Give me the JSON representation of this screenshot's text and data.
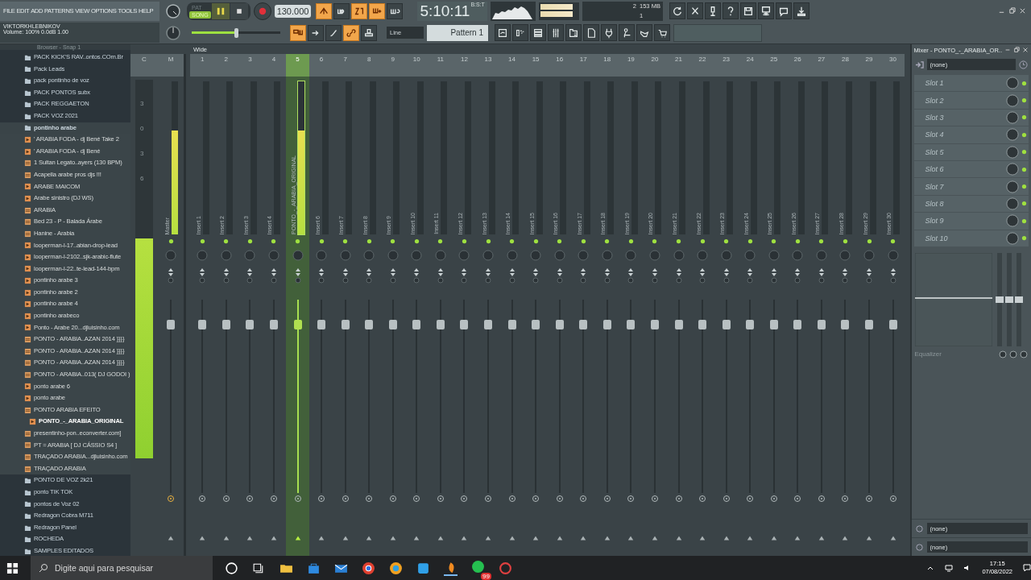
{
  "menu": [
    "FILE",
    "EDIT",
    "ADD",
    "PATTERNS",
    "VIEW",
    "OPTIONS",
    "TOOLS",
    "HELP"
  ],
  "hint": {
    "title": "VIKTORKHLEBNIKOV",
    "text": "Volume: 100%  0.0dB  1.00"
  },
  "transport": {
    "modes": [
      {
        "label": "PAT",
        "selected": false
      },
      {
        "label": "SONG",
        "selected": true
      }
    ],
    "tempo": "130.000",
    "time": "5:10:11",
    "time_unit": "B:S:T",
    "master_pitch": {
      "level": 0.5
    }
  },
  "toggles_top": [
    {
      "on": true
    },
    {
      "on": false
    },
    {
      "on": true
    },
    {
      "on": true
    },
    {
      "on": false
    }
  ],
  "toggles_bottom": [
    {
      "on": true
    },
    {
      "on": false
    },
    {
      "on": false
    },
    {
      "on": true
    },
    {
      "on": false
    }
  ],
  "cpu": {
    "voices": "2",
    "memory": "153 MB",
    "polyphony": "1"
  },
  "snap": "Line",
  "pattern": "Pattern 1",
  "browser": {
    "title": "Browser - Snap 1",
    "items": [
      {
        "kind": "folder",
        "name": "PACK KICK'S RAV..ontos.COm.Br",
        "selected": false
      },
      {
        "kind": "folder",
        "name": "Pack Leads",
        "selected": false
      },
      {
        "kind": "folder",
        "name": "pack pontinho de voz",
        "selected": false
      },
      {
        "kind": "folder",
        "name": "PACK PONTOS subx",
        "selected": false
      },
      {
        "kind": "folder",
        "name": "PACK REGGAETON",
        "selected": false
      },
      {
        "kind": "folder",
        "name": "PACK VOZ 2021",
        "selected": false
      },
      {
        "kind": "folder",
        "name": "pontinho arabe",
        "selected": false,
        "children": [
          {
            "kind": "audio",
            "name": "' ARABIA FODA -  dj Bené Take 2",
            "selected": false
          },
          {
            "kind": "audio",
            "name": "' ARABIA FODA -  dj Bené",
            "selected": false
          },
          {
            "kind": "mp3",
            "name": "1 Sultan Legato..ayers  (130 BPM)",
            "selected": false
          },
          {
            "kind": "mp3",
            "name": "Acapella arabe pros djs !!!",
            "selected": false
          },
          {
            "kind": "audio",
            "name": "ARABE MAICOM",
            "selected": false
          },
          {
            "kind": "audio",
            "name": "Arabe sinistro (DJ WS)",
            "selected": false
          },
          {
            "kind": "mp3",
            "name": "ARABIA",
            "selected": false
          },
          {
            "kind": "mp3",
            "name": "Bed 23 - P - Balada Árabe",
            "selected": false
          },
          {
            "kind": "mp3",
            "name": "Hanine - Arabia",
            "selected": false
          },
          {
            "kind": "audio",
            "name": "looperman-l-17..abian-drop-lead",
            "selected": false
          },
          {
            "kind": "audio",
            "name": "looperman-l-2102..sjk-arabic-flute",
            "selected": false
          },
          {
            "kind": "audio",
            "name": "looperman-l-22..te-lead-144-bpm",
            "selected": false
          },
          {
            "kind": "audio",
            "name": "pontinho  arabe 3",
            "selected": false
          },
          {
            "kind": "audio",
            "name": "pontinho arabe 2",
            "selected": false
          },
          {
            "kind": "audio",
            "name": "pontinho arabe 4",
            "selected": false
          },
          {
            "kind": "audio",
            "name": "pontinho arabeco",
            "selected": false
          },
          {
            "kind": "audio",
            "name": "Ponto - Arabe 20...djluisinho.com",
            "selected": false
          },
          {
            "kind": "mp3",
            "name": "PONTO - ARABIA..AZAN 2014 }}}}",
            "selected": false
          },
          {
            "kind": "mp3",
            "name": "PONTO - ARABIA..AZAN 2014 }}}}",
            "selected": false
          },
          {
            "kind": "mp3",
            "name": "PONTO - ARABIA..AZAN 2014 }}}}",
            "selected": false
          },
          {
            "kind": "mp3",
            "name": "PONTO - ARABIA..013( DJ GODOI )",
            "selected": false
          },
          {
            "kind": "audio",
            "name": "ponto arabe 6",
            "selected": false
          },
          {
            "kind": "audio",
            "name": "ponto arabe",
            "selected": false
          },
          {
            "kind": "mp3",
            "name": "PONTO ARABIA EFEITO",
            "selected": false,
            "children": [
              {
                "kind": "audio",
                "name": "PONTO_-_ARABIA_ORIGINAL",
                "selected": true
              }
            ]
          },
          {
            "kind": "mp3",
            "name": "presentinho-pon..econverter.com]",
            "selected": false
          },
          {
            "kind": "mp3",
            "name": "PT = ARABIA [ DJ CÁSSIO S4 ]",
            "selected": false
          },
          {
            "kind": "mp3",
            "name": "TRAÇADO ARABIA...djluisinho.com",
            "selected": false
          },
          {
            "kind": "mp3",
            "name": "TRAÇADO ARABIA",
            "selected": false
          }
        ]
      },
      {
        "kind": "folder",
        "name": "PONTO DE VOZ 2k21",
        "selected": false
      },
      {
        "kind": "folder",
        "name": "ponto TIK TOK",
        "selected": false
      },
      {
        "kind": "folder",
        "name": "pontos de Voz 02",
        "selected": false
      },
      {
        "kind": "folder",
        "name": "Redragon Cobra M711",
        "selected": false
      },
      {
        "kind": "folder",
        "name": "Redragon Panel",
        "selected": false
      },
      {
        "kind": "folder",
        "name": "ROCHEDA",
        "selected": false
      },
      {
        "kind": "folder",
        "name": "SAMPLES EDITADOS",
        "selected": false
      }
    ]
  },
  "mixer": {
    "stereo_mode": "Wide",
    "current": {
      "label": "C",
      "scale": [
        "3",
        "0",
        "3",
        "6"
      ],
      "meter": {
        "level": 0.58
      }
    },
    "channels": [
      {
        "label": "M",
        "name": "Master",
        "selected": false,
        "meter": {
          "level": 0.68
        },
        "fader": {
          "level": 0.87
        }
      },
      {
        "label": "1",
        "name": "Insert 1",
        "selected": false,
        "fader": {
          "level": 0.87
        }
      },
      {
        "label": "2",
        "name": "Insert 2",
        "selected": false,
        "fader": {
          "level": 0.87
        }
      },
      {
        "label": "3",
        "name": "Insert 3",
        "selected": false,
        "fader": {
          "level": 0.87
        }
      },
      {
        "label": "4",
        "name": "Insert 4",
        "selected": false,
        "fader": {
          "level": 0.87
        }
      },
      {
        "label": "5",
        "name": "PONTO_-_ARABIA_ORIGINAL",
        "selected": true,
        "meter": {
          "level": 0.68
        },
        "fader": {
          "level": 0.87
        }
      },
      {
        "label": "6",
        "name": "Insert 6",
        "selected": false,
        "fader": {
          "level": 0.87
        }
      },
      {
        "label": "7",
        "name": "Insert 7",
        "selected": false,
        "fader": {
          "level": 0.87
        }
      },
      {
        "label": "8",
        "name": "Insert 8",
        "selected": false,
        "fader": {
          "level": 0.87
        }
      },
      {
        "label": "9",
        "name": "Insert 9",
        "selected": false,
        "fader": {
          "level": 0.87
        }
      },
      {
        "label": "10",
        "name": "Insert 10",
        "selected": false,
        "fader": {
          "level": 0.87
        }
      },
      {
        "label": "11",
        "name": "Insert 11",
        "selected": false,
        "fader": {
          "level": 0.87
        }
      },
      {
        "label": "12",
        "name": "Insert 12",
        "selected": false,
        "fader": {
          "level": 0.87
        }
      },
      {
        "label": "13",
        "name": "Insert 13",
        "selected": false,
        "fader": {
          "level": 0.87
        }
      },
      {
        "label": "14",
        "name": "Insert 14",
        "selected": false,
        "fader": {
          "level": 0.87
        }
      },
      {
        "label": "15",
        "name": "Insert 15",
        "selected": false,
        "fader": {
          "level": 0.87
        }
      },
      {
        "label": "16",
        "name": "Insert 16",
        "selected": false,
        "fader": {
          "level": 0.87
        }
      },
      {
        "label": "17",
        "name": "Insert 17",
        "selected": false,
        "fader": {
          "level": 0.87
        }
      },
      {
        "label": "18",
        "name": "Insert 18",
        "selected": false,
        "fader": {
          "level": 0.87
        }
      },
      {
        "label": "19",
        "name": "Insert 19",
        "selected": false,
        "fader": {
          "level": 0.87
        }
      },
      {
        "label": "20",
        "name": "Insert 20",
        "selected": false,
        "fader": {
          "level": 0.87
        }
      },
      {
        "label": "21",
        "name": "Insert 21",
        "selected": false,
        "fader": {
          "level": 0.87
        }
      },
      {
        "label": "22",
        "name": "Insert 22",
        "selected": false,
        "fader": {
          "level": 0.87
        }
      },
      {
        "label": "23",
        "name": "Insert 23",
        "selected": false,
        "fader": {
          "level": 0.87
        }
      },
      {
        "label": "24",
        "name": "Insert 24",
        "selected": false,
        "fader": {
          "level": 0.87
        }
      },
      {
        "label": "25",
        "name": "Insert 25",
        "selected": false,
        "fader": {
          "level": 0.87
        }
      },
      {
        "label": "26",
        "name": "Insert 26",
        "selected": false,
        "fader": {
          "level": 0.87
        }
      },
      {
        "label": "27",
        "name": "Insert 27",
        "selected": false,
        "fader": {
          "level": 0.87
        }
      },
      {
        "label": "28",
        "name": "Insert 28",
        "selected": false,
        "fader": {
          "level": 0.87
        }
      },
      {
        "label": "29",
        "name": "Insert 29",
        "selected": false,
        "fader": {
          "level": 0.87
        }
      },
      {
        "label": "30",
        "name": "Insert 30",
        "selected": false,
        "fader": {
          "level": 0.87
        }
      }
    ]
  },
  "inspector": {
    "title": "Mixer - PONTO_-_ARABIA_OR..",
    "input": "(none)",
    "slots": [
      {
        "name": "Slot 1",
        "on": true
      },
      {
        "name": "Slot 2",
        "on": true
      },
      {
        "name": "Slot 3",
        "on": true
      },
      {
        "name": "Slot 4",
        "on": true
      },
      {
        "name": "Slot 5",
        "on": true
      },
      {
        "name": "Slot 6",
        "on": true
      },
      {
        "name": "Slot 7",
        "on": true
      },
      {
        "name": "Slot 8",
        "on": true
      },
      {
        "name": "Slot 9",
        "on": true
      },
      {
        "name": "Slot 10",
        "on": true
      }
    ],
    "eq_bands": [
      {
        "level": 0.5
      },
      {
        "level": 0.5
      },
      {
        "level": 0.5
      }
    ],
    "eq_label": "Equalizer",
    "outputs": [
      "(none)",
      "(none)"
    ]
  },
  "taskbar": {
    "search_placeholder": "Digite aqui para pesquisar",
    "time": "17:15",
    "date": "07/08/2022",
    "badge": "99"
  }
}
